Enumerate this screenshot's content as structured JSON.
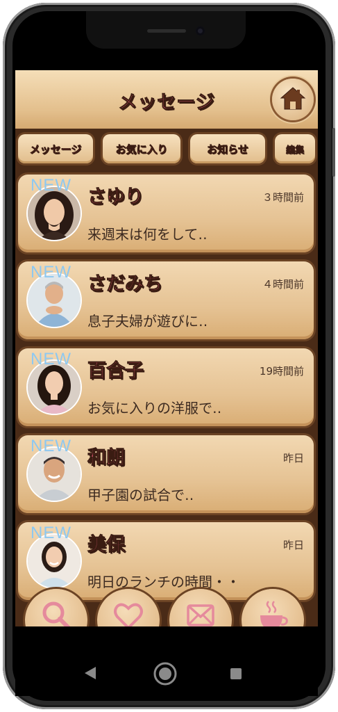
{
  "header": {
    "title": "メッセージ"
  },
  "tabs": [
    {
      "label": "メッセージ"
    },
    {
      "label": "お気に入り"
    },
    {
      "label": "お知らせ"
    },
    {
      "label": "編集"
    }
  ],
  "messages": [
    {
      "new": "NEW",
      "name": "さゆり",
      "time": "３時間前",
      "preview": "来週末は何をして‥"
    },
    {
      "new": "NEW",
      "name": "さだみち",
      "time": "４時間前",
      "preview": "息子夫婦が遊びに‥"
    },
    {
      "new": "NEW",
      "name": "百合子",
      "time": "19時間前",
      "preview": "お気に入りの洋服で‥"
    },
    {
      "new": "NEW",
      "name": "和朗",
      "time": "昨日",
      "preview": "甲子園の試合で‥"
    },
    {
      "new": "NEW",
      "name": "美保",
      "time": "昨日",
      "preview": "明日のランチの時間・・"
    }
  ],
  "icons": {
    "header": "home-icon",
    "bottom_nav": [
      "search-icon",
      "heart-icon",
      "mail-icon",
      "coffee-cup-icon"
    ],
    "system_nav": [
      "back-icon",
      "home-circle-icon",
      "recents-icon"
    ]
  },
  "colors": {
    "accent_text": "#e35a74",
    "card_bg": "#e5c293",
    "frame_brown": "#4a2b17",
    "new_badge": "#8ec8f0"
  }
}
